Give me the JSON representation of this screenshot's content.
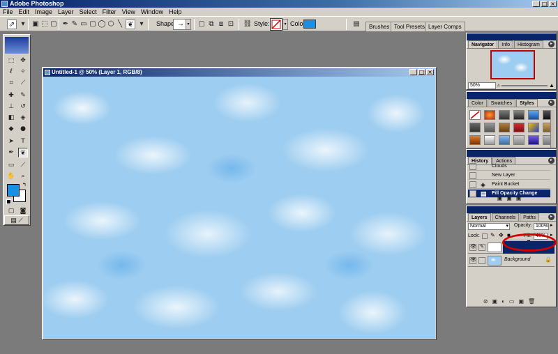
{
  "app": {
    "title": "Adobe Photoshop"
  },
  "menu": [
    "File",
    "Edit",
    "Image",
    "Layer",
    "Select",
    "Filter",
    "View",
    "Window",
    "Help"
  ],
  "options": {
    "shape_label": "Shape:",
    "style_label": "Style:",
    "color_label": "Color:",
    "color_value": "#1a8fe6",
    "well_tabs": [
      "Brushes",
      "Tool Presets",
      "Layer Comps"
    ]
  },
  "document": {
    "title": "Untitled-1 @ 50% (Layer 1, RGB/8)"
  },
  "navigator": {
    "tabs": [
      "Navigator",
      "Info",
      "Histogram"
    ],
    "zoom": "50%"
  },
  "styles": {
    "tabs": [
      "Color",
      "Swatches",
      "Styles"
    ]
  },
  "history": {
    "tabs": [
      "History",
      "Actions"
    ],
    "items": [
      "Clouds",
      "New Layer",
      "Paint Bucket",
      "Fill Opacity Change"
    ]
  },
  "layers": {
    "tabs": [
      "Layers",
      "Channels",
      "Paths"
    ],
    "blend_mode": "Normal",
    "opacity_label": "Opacity:",
    "opacity_value": "100%",
    "lock_label": "Lock:",
    "fill_label": "Fill:",
    "fill_value": "45%",
    "fill_slider": 0.45,
    "background_layer": "Background"
  }
}
